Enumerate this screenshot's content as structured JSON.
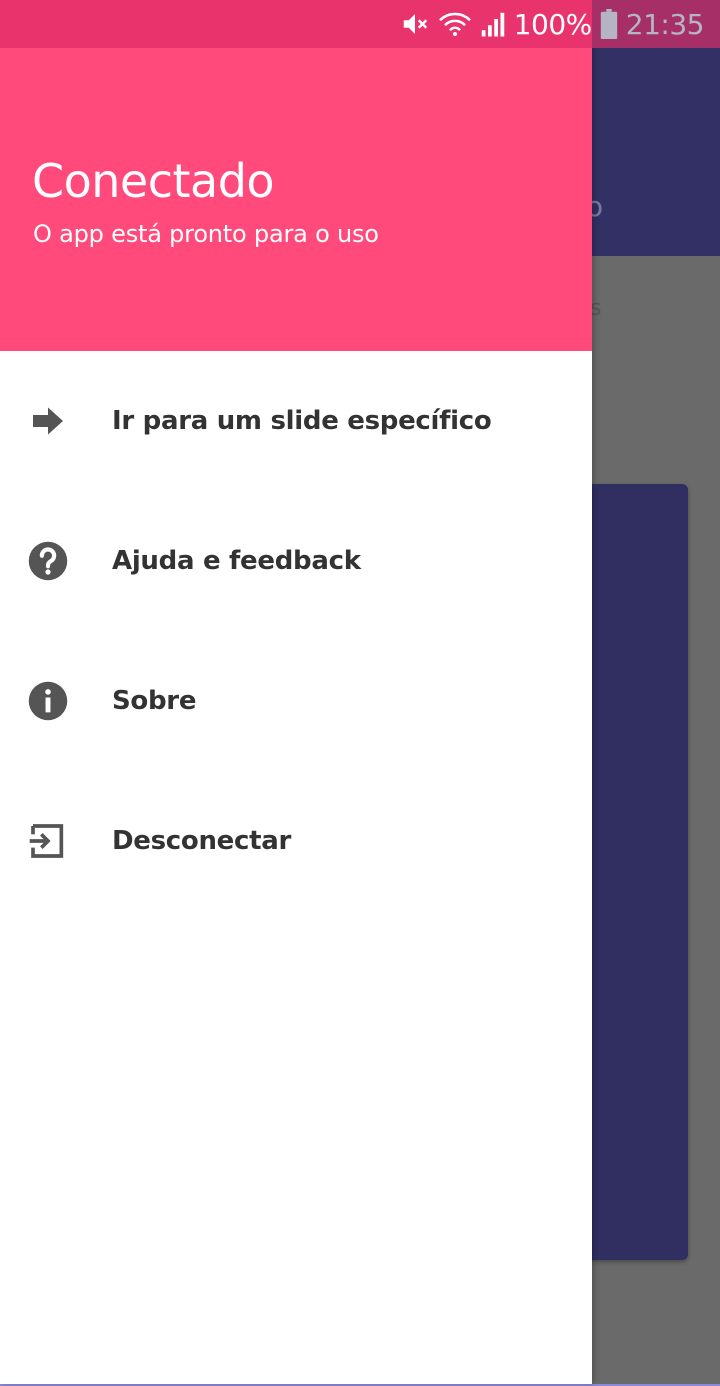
{
  "status_bar": {
    "battery_percent": "100%",
    "time": "21:35",
    "icons": [
      "mute-icon",
      "wifi-icon",
      "signal-icon",
      "battery-icon"
    ]
  },
  "background": {
    "toolbar_partial": "o",
    "content_partial": "s"
  },
  "drawer": {
    "header": {
      "title": "Conectado",
      "subtitle": "O app está pronto para o uso"
    },
    "items": [
      {
        "label": "Ir para um slide específico",
        "icon": "arrow-right-icon"
      },
      {
        "label": "Ajuda e feedback",
        "icon": "help-icon"
      },
      {
        "label": "Sobre",
        "icon": "info-icon"
      },
      {
        "label": "Desconectar",
        "icon": "exit-icon"
      }
    ]
  },
  "colors": {
    "status_bar": "#e8336d",
    "header": "#ff4a7b",
    "toolbar": "#323064",
    "icon": "#555555",
    "text": "#333333"
  }
}
